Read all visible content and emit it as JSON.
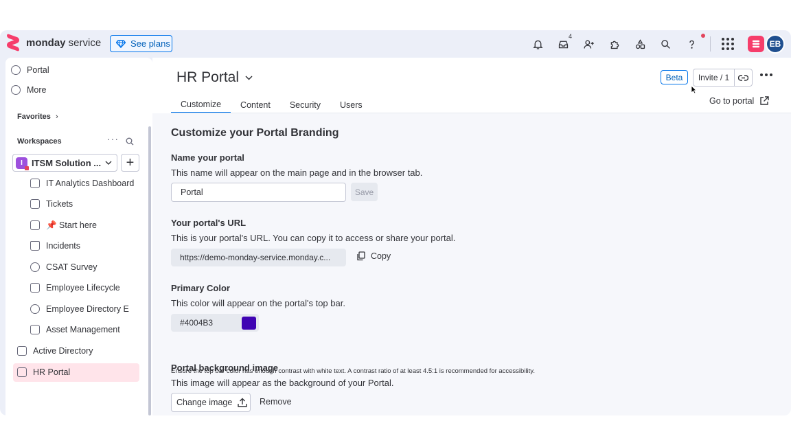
{
  "app": {
    "brand_bold": "monday",
    "brand_light": " service",
    "see_plans": "See plans",
    "inbox_count": "4",
    "avatar_initials": "EB"
  },
  "sidebar": {
    "top_items": [
      {
        "label": "Portal",
        "icon": "globe-icon"
      },
      {
        "label": "More",
        "icon": "more-circle-icon"
      }
    ],
    "favorites_label": "Favorites",
    "workspaces_label": "Workspaces",
    "workspace_name": "ITSM Solution ...",
    "workspace_initial": "I",
    "items": [
      {
        "label": "IT Analytics Dashboard",
        "icon": "dashboard-icon"
      },
      {
        "label": "Tickets",
        "icon": "tickets-icon"
      },
      {
        "label": "📌 Start here",
        "icon": "doc-icon"
      },
      {
        "label": "Incidents",
        "icon": "warning-icon"
      },
      {
        "label": "CSAT Survey",
        "icon": "gauge-icon"
      },
      {
        "label": "Employee Lifecycle",
        "icon": "board-icon"
      },
      {
        "label": "Employee Directory E",
        "icon": "people-icon"
      },
      {
        "label": "Asset Management",
        "icon": "board-icon"
      }
    ],
    "active_directory": "Active Directory",
    "hr_portal": "HR Portal"
  },
  "header": {
    "title": "HR Portal",
    "beta": "Beta",
    "invite": "Invite / 1",
    "go_to_portal": "Go to portal",
    "tabs": [
      "Customize",
      "Content",
      "Security",
      "Users"
    ]
  },
  "customize": {
    "heading": "Customize your Portal Branding",
    "name_label": "Name your portal",
    "name_desc": "This name will appear on the main page and in the browser tab.",
    "name_value": "Portal",
    "save": "Save",
    "url_label": "Your portal's URL",
    "url_desc": "This is your portal's URL. You can copy it to access or share your portal.",
    "url_value": "https://demo-monday-service.monday.c...",
    "copy": "Copy",
    "color_label": "Primary Color",
    "color_desc": "This color will appear on the portal's top bar.",
    "color_value": "#4004B3",
    "color_note": "Ensure the top bar color has enough contrast with white text. A contrast ratio of at least 4.5:1 is recommended for accessibility.",
    "bg_label": "Portal background image",
    "bg_desc": "This image will appear as the background of your Portal.",
    "change_image": "Change image",
    "remove": "Remove"
  },
  "colors": {
    "accent": "#0073ea",
    "primary_swatch": "#4004B3",
    "selected_bg": "#ffe4ea"
  }
}
